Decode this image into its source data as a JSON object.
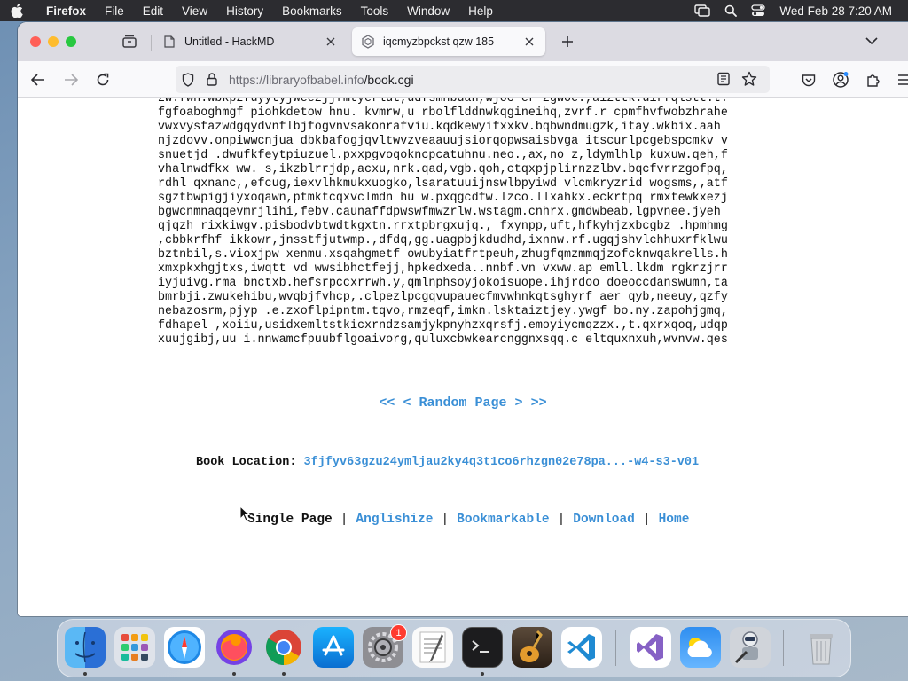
{
  "menubar": {
    "app_name": "Firefox",
    "items": [
      "File",
      "Edit",
      "View",
      "History",
      "Bookmarks",
      "Tools",
      "Window",
      "Help"
    ],
    "clock": "Wed Feb 28  7:20 AM"
  },
  "browser": {
    "tabs": [
      {
        "title": "Untitled - HackMD",
        "active": false,
        "favicon": "document-icon"
      },
      {
        "title": "iqcmyzbpckst qzw 185",
        "active": true,
        "favicon": "babel-icon"
      }
    ],
    "url_domain": "https://libraryofbabel.info",
    "url_path": "/book.cgi"
  },
  "page": {
    "text_lines": [
      "zw.fwh.wbkpzfuyytyjweezjjfmtyerldt,udfsmhbdah,wjoc er zgwoe.,aizttk.uirfqlstt.t.",
      "fgfoaboghmgf piohkdetow hnu. kvmrw,u rbolflddnwkqgineihq,zvrf.r cpmfhvfwobzhrahe",
      "vwxvysfazwdgqydvnflbjfogvnvsakonrafviu.kqdkewyifxxkv.bqbwndmugzk,itay.wkbix.aah",
      "njzdovv.onpiwwcnjua dbkbafogjqvltwvzveaauujsiorqopwsaisbvga itscurlpcgebspcmkv v",
      "snuetjd .dwufkfeytpiuzuel.pxxpgvoqokncpcatuhnu.neo.,ax,no z,ldymlhlp kuxuw.qeh,f",
      "vhalnwdfkx ww. s,ikzblrrjdp,acxu,nrk.qad,vgb.qoh,ctqxpjplirnzzlbv.bqcfvrrzgofpq,",
      "rdhl qxnanc,,efcug,iexvlhkmukxuogko,lsaratuuijnswlbpyiwd vlcmkryzrid wogsms,,atf",
      "sgztbwpigjiyxoqawn,ptmktcqxvclmdn hu w.pxqgcdfw.lzco.llxahkx.eckrtpq rmxtewkxezj",
      "bgwcnmnaqqevmrjlihi,febv.caunaffdpwswfmwzrlw.wstagm.cnhrx.gmdwbeab,lgpvnee.jyeh",
      "qjqzh rixkiwgv.pisbodvbtwdtkgxtn.rrxtpbrgxujq., fxynpp,uft,hfkyhjzxbcgbz .hpmhmg",
      ",cbbkrfhf ikkowr,jnsstfjutwmp.,dfdq,gg.uagpbjkdudhd,ixnnw.rf.ugqjshvlchhuxrfklwu",
      "bztnbil,s.vioxjpw xenmu.xsqahgmetf owubyiatfrtpeuh,zhugfqmzmmqjzofcknwqakrells.h",
      "xmxpkxhgjtxs,iwqtt vd wwsibhctfejj,hpkedxeda..nnbf.vn vxww.ap emll.lkdm rgkrzjrr",
      "iyjuivg.rma bnctxb.hefsrpccxrrwh.y,qmlnphsoyjokoisuope.ihjrdoo doeoccdanswumn,ta",
      "bmrbji.zwukehibu,wvqbjfvhcp,.clpezlpcgqvupauecfmvwhnkqtsghyrf aer qyb,neeuy,qzfy",
      "nebazosrm,pjyp .e.zxoflpipntm.tqvo,rmzeqf,imkn.lsktaiztjey.ywgf bo.ny.zapohjgmq,",
      "fdhapel ,xoiiu,usidxemltstkicxrndzsamjykpnyhzxqrsfj.emoyiycmqzzx.,t.qxrxqoq,udqp",
      "xuujgibj,uu i.nnwamcfpuubflgoaivorg,quluxcbwkearcnggnxsqq.c eltquxnxuh,wvnvw.qes"
    ],
    "nav": {
      "first": "<<",
      "prev": "<",
      "random": "Random Page",
      "next": ">",
      "last": ">>"
    },
    "book_location_label": "Book Location:",
    "book_location_value": "3fjfyv63gzu24ymljau2ky4q3t1co6rhzgn02e78pa...-w4-s3-v01",
    "footer": {
      "current": "Single Page",
      "links": [
        "Anglishize",
        "Bookmarkable",
        "Download",
        "Home"
      ]
    }
  },
  "dock": {
    "apps": [
      "finder-icon",
      "launchpad-icon",
      "safari-icon",
      "firefox-icon",
      "chrome-icon",
      "app-store-icon",
      "system-settings-icon",
      "textedit-icon",
      "terminal-icon",
      "garageband-icon",
      "vscode-icon",
      "visual-studio-icon",
      "weather-icon",
      "automator-icon",
      "trash-icon"
    ],
    "settings_badge": "1"
  },
  "colors": {
    "link": "#3a8fd6",
    "menubar": "#2c2c30",
    "tabbar": "#dcdbe2"
  }
}
